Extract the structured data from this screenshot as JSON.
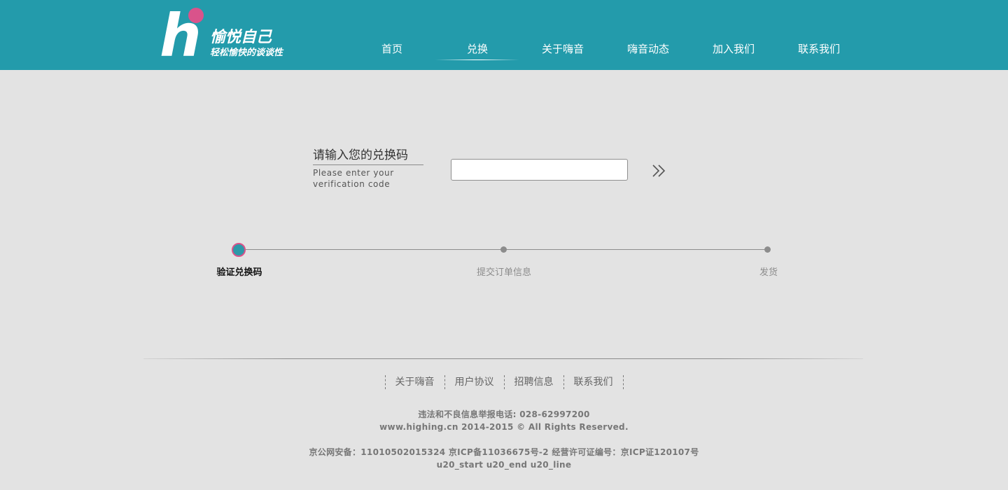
{
  "header": {
    "logo": {
      "letter": "h",
      "title": "愉悦自己",
      "subtitle": "轻松愉快的谈谈性"
    },
    "nav": [
      {
        "label": "首页"
      },
      {
        "label": "兑换",
        "active": true
      },
      {
        "label": "关于嗨音"
      },
      {
        "label": "嗨音动态"
      },
      {
        "label": "加入我们"
      },
      {
        "label": "联系我们"
      }
    ]
  },
  "redeem": {
    "prompt_cn": "请输入您的兑换码",
    "prompt_en": "Please enter your verification code",
    "input_value": "",
    "submit_icon": "double-chevron-right-icon"
  },
  "steps": [
    {
      "label": "验证兑换码",
      "active": true
    },
    {
      "label": "提交订单信息",
      "active": false
    },
    {
      "label": "发货",
      "active": false
    }
  ],
  "footer": {
    "links": [
      {
        "label": "关于嗨音"
      },
      {
        "label": "用户协议"
      },
      {
        "label": "招聘信息"
      },
      {
        "label": "联系我们"
      }
    ],
    "report_line": "违法和不良信息举报电话: 028-62997200",
    "copyright": "www.highing.cn 2014-2015 © All Rights Reserved.",
    "icp": "京公网安备：11010502015324 京ICP备11036675号-2 经营许可证编号：京ICP证120107号",
    "placeholder_line": "u20_start u20_end u20_line"
  },
  "colors": {
    "header_bg": "#239bab",
    "accent_pink": "#d9538b",
    "page_bg": "#e3e3e3"
  }
}
